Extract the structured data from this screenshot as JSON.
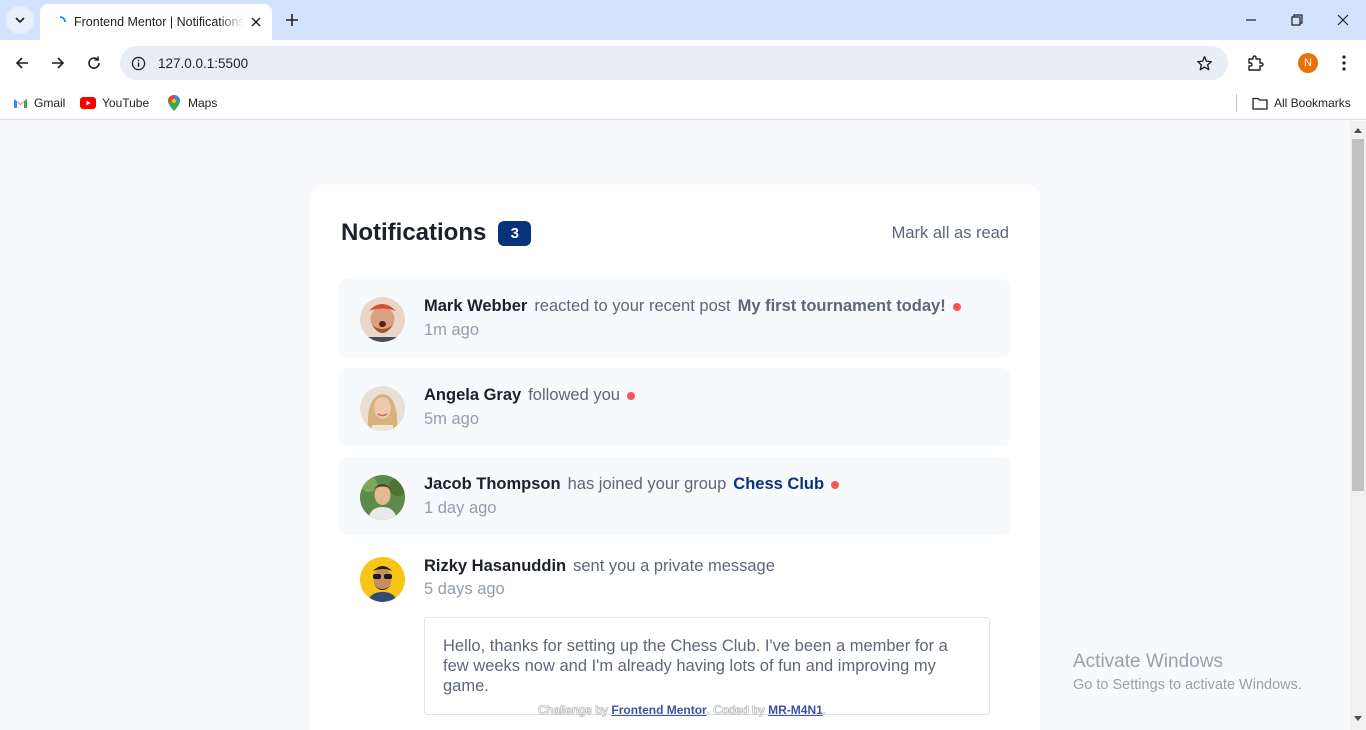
{
  "browser": {
    "tab_title": "Frontend Mentor | Notifications page",
    "url": "127.0.0.1:5500",
    "profile_initial": "N",
    "bookmarks": [
      "Gmail",
      "YouTube",
      "Maps"
    ],
    "all_bookmarks": "All Bookmarks"
  },
  "page": {
    "title": "Notifications",
    "unread_count": "3",
    "mark_all": "Mark all as read",
    "notifications": [
      {
        "name": "Mark Webber",
        "action": "reacted to your recent post",
        "target": "My first tournament today!",
        "time": "1m ago",
        "unread": true
      },
      {
        "name": "Angela Gray",
        "action": "followed you",
        "target": "",
        "time": "5m ago",
        "unread": true
      },
      {
        "name": "Jacob Thompson",
        "action": "has joined your group",
        "target": "Chess Club",
        "time": "1 day ago",
        "unread": true
      },
      {
        "name": "Rizky Hasanuddin",
        "action": "sent you a private message",
        "target": "",
        "time": "5 days ago",
        "unread": false,
        "message": "Hello, thanks for setting up the Chess Club. I've been a member for a few weeks now and I'm already having lots of fun and improving my game."
      }
    ],
    "attribution": {
      "prefix": "Challenge by",
      "mentor": "Frontend Mentor",
      "middle": ". Coded by",
      "author": "MR-M4N1",
      "suffix": "."
    }
  },
  "os_overlay": {
    "line1": "Activate Windows",
    "line2": "Go to Settings to activate Windows."
  },
  "colors": {
    "accent": "#0a327b",
    "unread_dot": "#f65552",
    "unread_bg": "#f7fafd"
  }
}
